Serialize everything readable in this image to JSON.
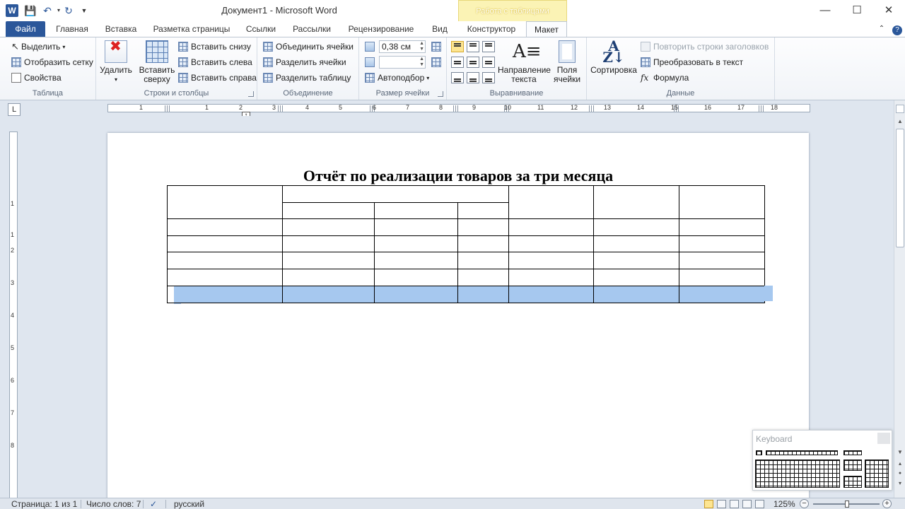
{
  "title_bar": {
    "document_title": "Документ1 - Microsoft Word",
    "context_tab_group": "Работа с таблицами",
    "app_icon": "word-icon",
    "quick_access": [
      "save-icon",
      "undo-icon",
      "redo-icon",
      "customize-icon"
    ]
  },
  "tabs": [
    {
      "label": "Файл"
    },
    {
      "label": "Главная"
    },
    {
      "label": "Вставка"
    },
    {
      "label": "Разметка страницы"
    },
    {
      "label": "Ссылки"
    },
    {
      "label": "Рассылки"
    },
    {
      "label": "Рецензирование"
    },
    {
      "label": "Вид"
    },
    {
      "label": "Конструктор"
    },
    {
      "label": "Макет"
    }
  ],
  "active_tab": "Макет",
  "ribbon": {
    "table_group": {
      "label": "Таблица",
      "select": "Выделить",
      "show_grid": "Отобразить сетку",
      "properties": "Свойства"
    },
    "rows_cols_group": {
      "label": "Строки и столбцы",
      "delete": "Удалить",
      "insert_above_l1": "Вставить",
      "insert_above_l2": "сверху",
      "insert_below": "Вставить снизу",
      "insert_left": "Вставить слева",
      "insert_right": "Вставить справа"
    },
    "merge_group": {
      "label": "Объединение",
      "merge_cells": "Объединить ячейки",
      "split_cells": "Разделить ячейки",
      "split_table": "Разделить таблицу"
    },
    "cell_size_group": {
      "label": "Размер ячейки",
      "height_value": "0,38 см",
      "width_value": "",
      "autofit": "Автоподбор"
    },
    "alignment_group": {
      "label": "Выравнивание",
      "text_direction_l1": "Направление",
      "text_direction_l2": "текста",
      "cell_margins_l1": "Поля",
      "cell_margins_l2": "ячейки"
    },
    "data_group": {
      "label": "Данные",
      "sort": "Сортировка",
      "repeat_header": "Повторить строки заголовков",
      "convert_to_text": "Преобразовать в текст",
      "formula": "Формула"
    }
  },
  "ruler": {
    "numbers": [
      "1",
      "1",
      "2",
      "3",
      "4",
      "5",
      "6",
      "7",
      "8",
      "9",
      "10",
      "11",
      "12",
      "13",
      "14",
      "15",
      "16",
      "17",
      "18"
    ],
    "vertical_numbers": [
      "1",
      "1",
      "2",
      "3",
      "4",
      "5",
      "6",
      "7",
      "8"
    ]
  },
  "document": {
    "heading": "Отчёт по реализации товаров за три месяца",
    "table_rows": 7,
    "selected_row": 7
  },
  "keyboard_panel": {
    "title": "Keyboard"
  },
  "status_bar": {
    "page": "Страница: 1 из 1",
    "word_count": "Число слов: 7",
    "language": "русский",
    "zoom": "125%",
    "zoom_level_fraction": 0.5
  },
  "colors": {
    "accent": "#2b579a",
    "selection": "#a6c8ef",
    "context_tab": "#fbf3b5"
  }
}
